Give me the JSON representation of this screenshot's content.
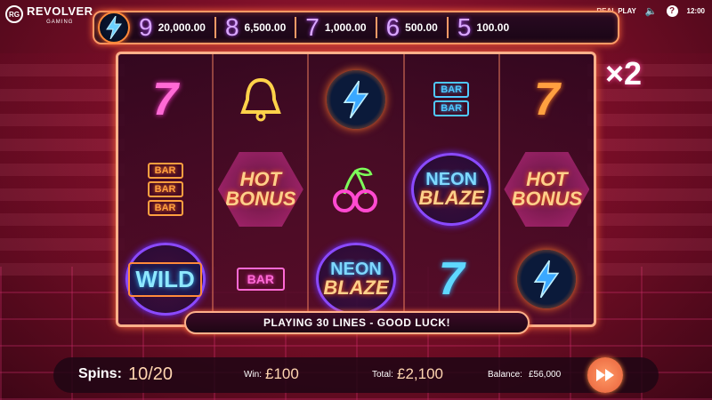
{
  "brand": {
    "mark": "RG",
    "name": "REVOLVER",
    "subtitle": "GAMING"
  },
  "top_right": {
    "mode": "REAL PLAY",
    "help": "?",
    "clock": "12:00"
  },
  "paytable": [
    {
      "count": "9",
      "value": "20,000.00"
    },
    {
      "count": "8",
      "value": "6,500.00"
    },
    {
      "count": "7",
      "value": "1,000.00"
    },
    {
      "count": "6",
      "value": "500.00"
    },
    {
      "count": "5",
      "value": "100.00"
    }
  ],
  "multiplier": "×2",
  "reels": [
    [
      "seven-pink",
      "bar-triple-orange",
      "wild"
    ],
    [
      "bell",
      "hot-bonus",
      "bar-single-pink"
    ],
    [
      "bolt",
      "cherry",
      "neon-blaze"
    ],
    [
      "bar-double-cyan",
      "neon-blaze",
      "seven-cyan"
    ],
    [
      "seven-orange",
      "hot-bonus",
      "bolt"
    ]
  ],
  "symbols": {
    "bar": "BAR",
    "hot": "HOT",
    "bonus": "BONUS",
    "neon": "NEON",
    "blaze": "BLAZE",
    "wild": "WILD"
  },
  "message": "PLAYING 30 LINES - GOOD LUCK!",
  "bottom": {
    "spins_label": "Spins:",
    "spins_value": "10/20",
    "win_label": "Win:",
    "win_value": "£100",
    "total_label": "Total:",
    "total_value": "£2,100",
    "balance_label": "Balance:",
    "balance_value": "£56,000"
  },
  "colors": {
    "accent": "#ff9a66",
    "background": "#7c0f28",
    "neon_pink": "#ff6ad5",
    "neon_cyan": "#4fc8ff"
  }
}
